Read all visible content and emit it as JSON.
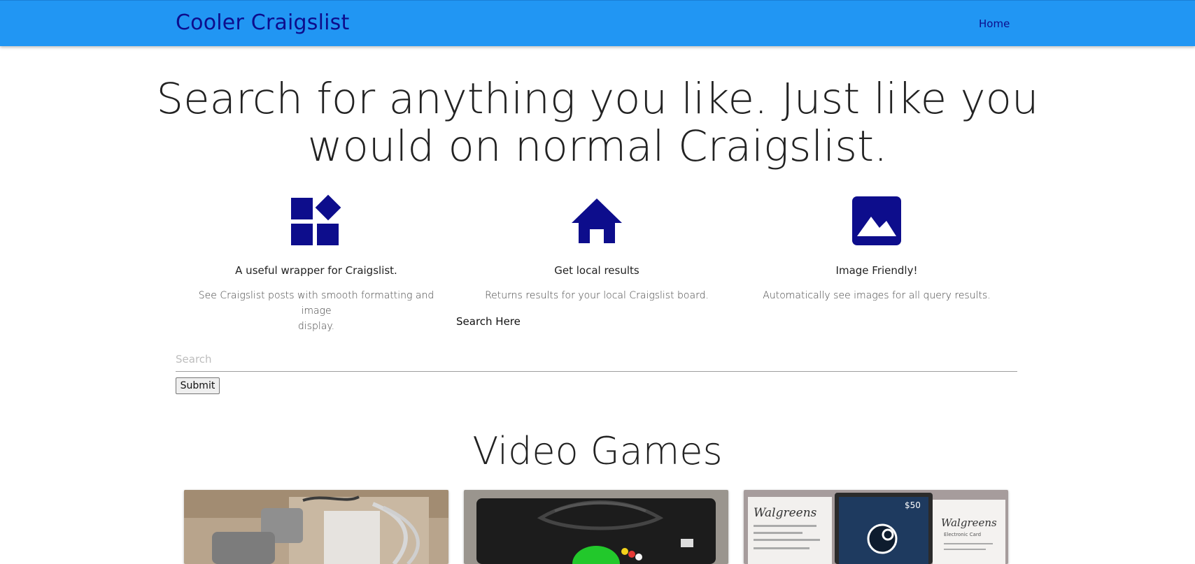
{
  "navbar": {
    "brand": "Cooler Craigslist",
    "home_link": "Home"
  },
  "hero": {
    "line1": "Search for anything you like. Just like you",
    "line2": "would on normal Craigslist."
  },
  "features": [
    {
      "icon": "widgets-icon",
      "title": "A useful wrapper for Craigslist.",
      "description_line1": "See Craigslist posts with smooth formatting and image",
      "description_line2": "display."
    },
    {
      "icon": "home-icon",
      "title": "Get local results",
      "description_line1": "Returns results for your local Craigslist board.",
      "description_line2": ""
    },
    {
      "icon": "image-icon",
      "title": "Image Friendly!",
      "description_line1": "Automatically see images for all query results.",
      "description_line2": ""
    }
  ],
  "search": {
    "label": "Search Here",
    "placeholder": "Search",
    "value": "",
    "submit_label": "Submit"
  },
  "section": {
    "title": "Video Games"
  },
  "colors": {
    "navbar": "#2196f3",
    "brand_text": "#0d0d8c",
    "icon": "#0d0d8c"
  },
  "cards": [
    {
      "image": "console-with-cables-photo"
    },
    {
      "image": "original-xbox-console-photo"
    },
    {
      "image": "receipts-and-steam-gift-card-photo"
    }
  ],
  "card_texts": {
    "receipt_left": "Walgreens",
    "gift_card_amount": "$50",
    "receipt_right": "Walgreens",
    "receipt_right_sub": "Electronic Card"
  }
}
